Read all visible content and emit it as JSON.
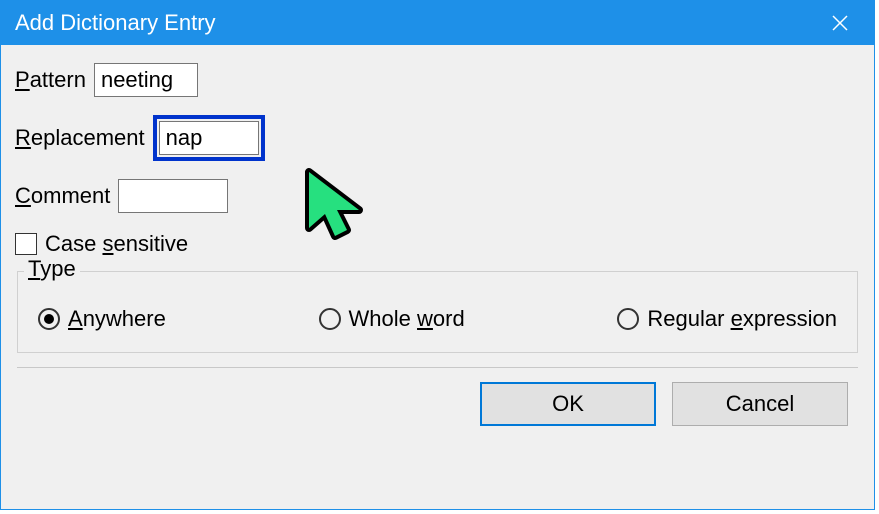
{
  "window": {
    "title": "Add Dictionary Entry",
    "close_icon": "close"
  },
  "fields": {
    "pattern": {
      "label_pre": "P",
      "label_rest": "attern",
      "value": "neeting"
    },
    "replacement": {
      "label_pre": "R",
      "label_rest": "eplacement",
      "value": "nap"
    },
    "comment": {
      "label_pre": "C",
      "label_rest": "omment",
      "value": ""
    }
  },
  "checkbox": {
    "case_sensitive": {
      "pre": "Case ",
      "u": "s",
      "post": "ensitive",
      "checked": false
    }
  },
  "type_group": {
    "legend_pre": "T",
    "legend_rest": "ype",
    "options": [
      {
        "id": "anywhere",
        "pre": "",
        "u": "A",
        "post": "nywhere",
        "selected": true
      },
      {
        "id": "wholeword",
        "pre": "Whole ",
        "u": "w",
        "post": "ord",
        "selected": false
      },
      {
        "id": "regex",
        "pre": "Regular ",
        "u": "e",
        "post": "xpression",
        "selected": false
      }
    ]
  },
  "buttons": {
    "ok": "OK",
    "cancel": "Cancel"
  }
}
